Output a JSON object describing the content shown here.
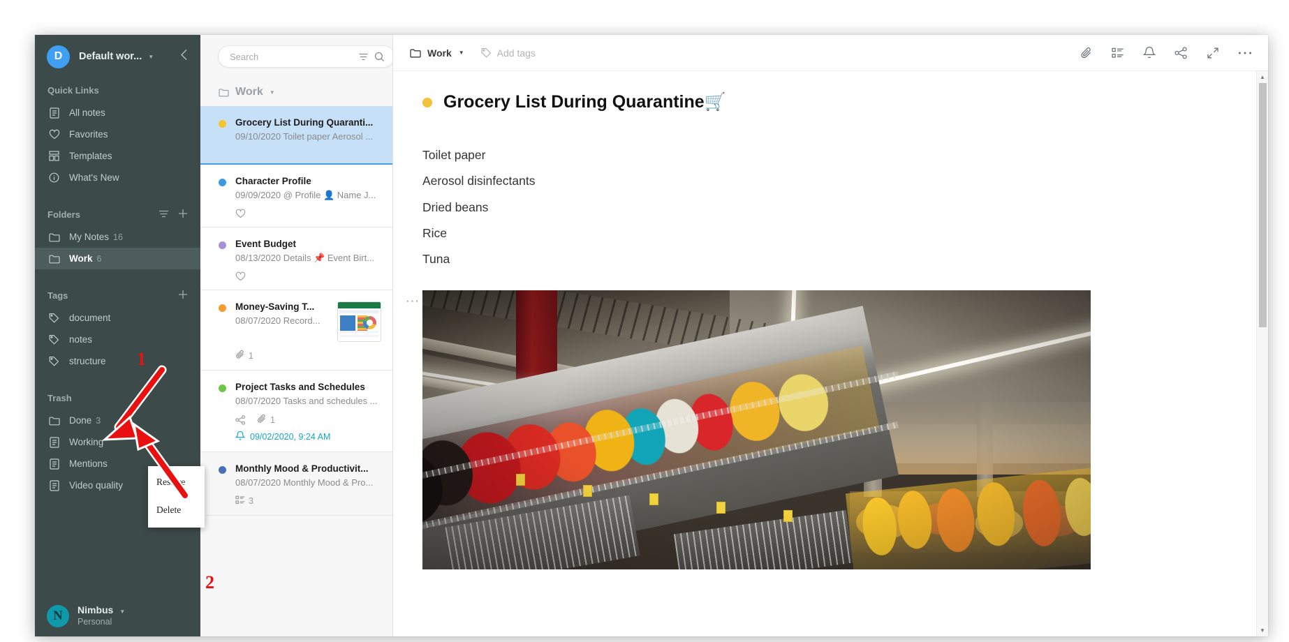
{
  "workspace": {
    "avatar_letter": "D",
    "name": "Default wor...",
    "caret": "▼",
    "collapse_icon": "chevron-left"
  },
  "sidebar": {
    "quick_links_title": "Quick Links",
    "quick_links": [
      {
        "label": "All notes",
        "icon": "note-icon"
      },
      {
        "label": "Favorites",
        "icon": "heart-icon"
      },
      {
        "label": "Templates",
        "icon": "templates-icon"
      },
      {
        "label": "What's New",
        "icon": "info-icon"
      }
    ],
    "folders_title": "Folders",
    "folders": [
      {
        "label": "My Notes",
        "count": "16",
        "active": false
      },
      {
        "label": "Work",
        "count": "6",
        "active": true
      }
    ],
    "tags_title": "Tags",
    "tags": [
      {
        "label": "document"
      },
      {
        "label": "notes"
      },
      {
        "label": "structure"
      }
    ],
    "trash_title": "Trash",
    "trash": [
      {
        "label": "Done",
        "count": "3",
        "icon": "folder-icon"
      },
      {
        "label": "Working",
        "count": "",
        "icon": "note-icon"
      },
      {
        "label": "Mentions",
        "count": "",
        "icon": "note-icon"
      },
      {
        "label": "Video quality",
        "count": "",
        "icon": "note-icon"
      }
    ]
  },
  "context_menu": {
    "items": [
      {
        "label": "Restore"
      },
      {
        "label": "Delete"
      }
    ]
  },
  "user": {
    "avatar_letter": "N",
    "name": "Nimbus",
    "caret": "▼",
    "plan": "Personal"
  },
  "notelist": {
    "search_placeholder": "Search",
    "search_value": "",
    "filter_icon": "filter-icon",
    "search_icon": "search-icon",
    "add_label": "+",
    "folder_label": "Work",
    "folder_caret": "▼",
    "notes": [
      {
        "title": "Grocery List During Quaranti...",
        "date": "09/10/2020",
        "preview": "Toilet paper Aerosol ...",
        "dot_color": "#f5c32c",
        "selected": true,
        "favorite": false,
        "share": false,
        "attach_count": "",
        "todo_count": "",
        "reminder": "",
        "thumb": false
      },
      {
        "title": "Character Profile",
        "date": "09/09/2020",
        "preview": "@ Profile 👤 Name J...",
        "dot_color": "#3b9ae1",
        "selected": false,
        "favorite": true,
        "share": false,
        "attach_count": "",
        "todo_count": "",
        "reminder": "",
        "thumb": false
      },
      {
        "title": "Event Budget",
        "date": "08/13/2020",
        "preview": "Details 📌 Event Birt...",
        "dot_color": "#a88fd6",
        "selected": false,
        "favorite": true,
        "share": false,
        "attach_count": "",
        "todo_count": "",
        "reminder": "",
        "thumb": false
      },
      {
        "title": "Money-Saving T...",
        "date": "08/07/2020",
        "preview": "Record...",
        "dot_color": "#f59c33",
        "selected": false,
        "favorite": false,
        "share": false,
        "attach_count": "1",
        "todo_count": "",
        "reminder": "",
        "thumb": true
      },
      {
        "title": "Project Tasks and Schedules",
        "date": "08/07/2020",
        "preview": "Tasks and schedules ...",
        "dot_color": "#6cc644",
        "selected": false,
        "favorite": false,
        "share": true,
        "attach_count": "1",
        "todo_count": "",
        "reminder": "09/02/2020, 9:24 AM",
        "thumb": false
      },
      {
        "title": "Monthly Mood & Productivit...",
        "date": "08/07/2020",
        "preview": "Monthly Mood & Pro...",
        "dot_color": "#4a6fb5",
        "selected": false,
        "favorite": false,
        "share": false,
        "attach_count": "",
        "todo_count": "3",
        "reminder": "",
        "thumb": false
      }
    ]
  },
  "editor": {
    "folder_label": "Work",
    "folder_caret": "▼",
    "add_tags_label": "Add tags",
    "actions": [
      {
        "name": "attachment-icon"
      },
      {
        "name": "outline-icon"
      },
      {
        "name": "bell-icon"
      },
      {
        "name": "share-icon"
      },
      {
        "name": "expand-icon"
      },
      {
        "name": "more-icon"
      }
    ],
    "title": "Grocery List During Quarantine🛒",
    "title_dot_color": "#f3c13a",
    "lines": [
      "Toilet paper",
      "Aerosol disinfectants",
      "Dried beans",
      "Rice",
      "Tuna"
    ],
    "image_menu_label": "···",
    "image_alt": "supermarket aisle interior photo"
  },
  "annotations": [
    {
      "label": "1"
    },
    {
      "label": "2"
    }
  ]
}
